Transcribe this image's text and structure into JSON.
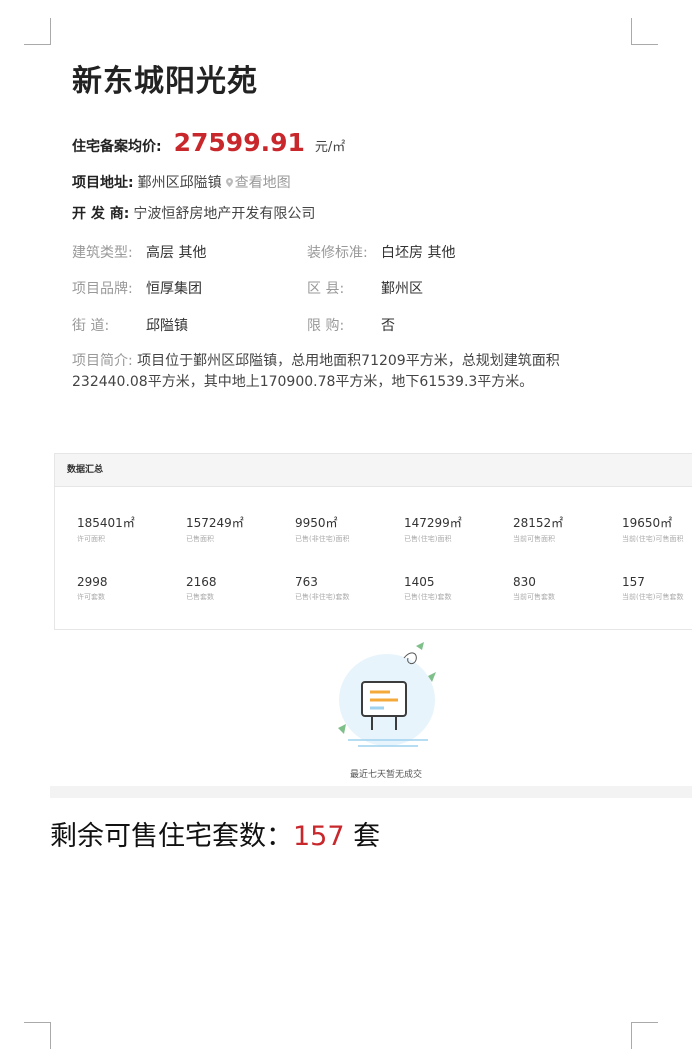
{
  "project": {
    "title": "新东城阳光苑",
    "price_label": "住宅备案均价:",
    "price_value": "27599.91",
    "price_unit": "元/㎡",
    "address_label": "项目地址:",
    "address_value": "鄞州区邱隘镇",
    "map_link": "查看地图",
    "developer_label": "开 发 商:",
    "developer_value": "宁波恒舒房地产开发有限公司"
  },
  "attributes": [
    {
      "label": "建筑类型:",
      "value": "高层 其他"
    },
    {
      "label": "装修标准:",
      "value": "白坯房 其他"
    },
    {
      "label": "项目品牌:",
      "value": "恒厚集团"
    },
    {
      "label": "区 县:",
      "value": "鄞州区"
    },
    {
      "label": "街 道:",
      "value": "邱隘镇"
    },
    {
      "label": "限 购:",
      "value": "否"
    }
  ],
  "intro": {
    "label": "项目简介:",
    "text": "项目位于鄞州区邱隘镇，总用地面积71209平方米，总规划建筑面积232440.08平方米，其中地上170900.78平方米，地下61539.3平方米。"
  },
  "summary": {
    "title": "数据汇总",
    "stats": [
      {
        "value": "185401㎡",
        "caption": "许可面积"
      },
      {
        "value": "157249㎡",
        "caption": "已售面积"
      },
      {
        "value": "9950㎡",
        "caption": "已售(非住宅)面积"
      },
      {
        "value": "147299㎡",
        "caption": "已售(住宅)面积"
      },
      {
        "value": "28152㎡",
        "caption": "当前可售面积"
      },
      {
        "value": "19650㎡",
        "caption": "当前(住宅)可售面积"
      },
      {
        "value": "2998",
        "caption": "许可套数"
      },
      {
        "value": "2168",
        "caption": "已售套数"
      },
      {
        "value": "763",
        "caption": "已售(非住宅)套数"
      },
      {
        "value": "1405",
        "caption": "已售(住宅)套数"
      },
      {
        "value": "830",
        "caption": "当前可售套数"
      },
      {
        "value": "157",
        "caption": "当前(住宅)可售套数"
      }
    ]
  },
  "empty_state": {
    "icon": "signboard-illustration",
    "text": "最近七天暂无成交"
  },
  "remaining": {
    "label": "剩余可售住宅套数：",
    "count": "157",
    "unit": "套"
  },
  "colors": {
    "accent": "#c8272b"
  }
}
